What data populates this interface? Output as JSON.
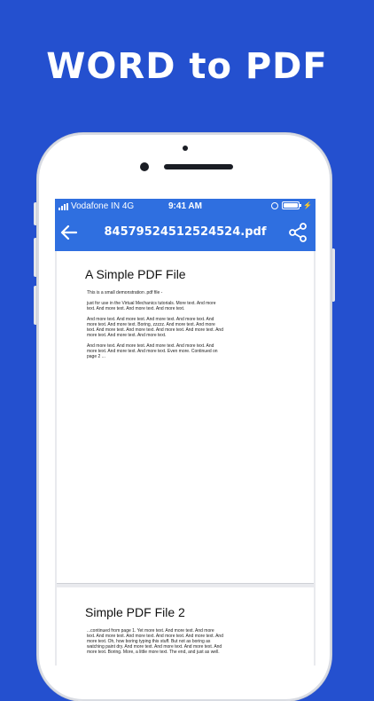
{
  "headline": "WORD to PDF",
  "status_bar": {
    "carrier": "Vodafone IN 4G",
    "time": "9:41 AM"
  },
  "app_bar": {
    "title": "84579524512524524.pdf",
    "back_icon": "arrow-left-icon",
    "share_icon": "share-icon"
  },
  "document": {
    "page1": {
      "title": "A Simple PDF File",
      "paragraphs": [
        "This is a small demonstration .pdf file -",
        "just for use in the Virtual Mechanics tutorials. More text. And more text. And more text. And more text. And more text.",
        "And more text. And more text. And more text. And more text. And more text. And more text. Boring, zzzzz. And more text. And more text. And more text. And more text. And more text. And more text. And more text. And more text. And more text.",
        "And more text. And more text. And more text. And more text. And more text. And more text. And more text. Even more. Continued on page 2 ..."
      ]
    },
    "page2": {
      "title": "Simple PDF File 2",
      "paragraphs": [
        "...continued from page 1. Yet more text. And more text. And more text. And more text. And more text. And more text. And more text. And more text. Oh, how boring typing this stuff. But not as boring as watching paint dry. And more text. And more text. And more text. And more text. Boring. More, a little more text. The end, and just as well."
      ]
    }
  },
  "colors": {
    "background": "#2450cf",
    "app_bar": "#2f6fe0"
  }
}
